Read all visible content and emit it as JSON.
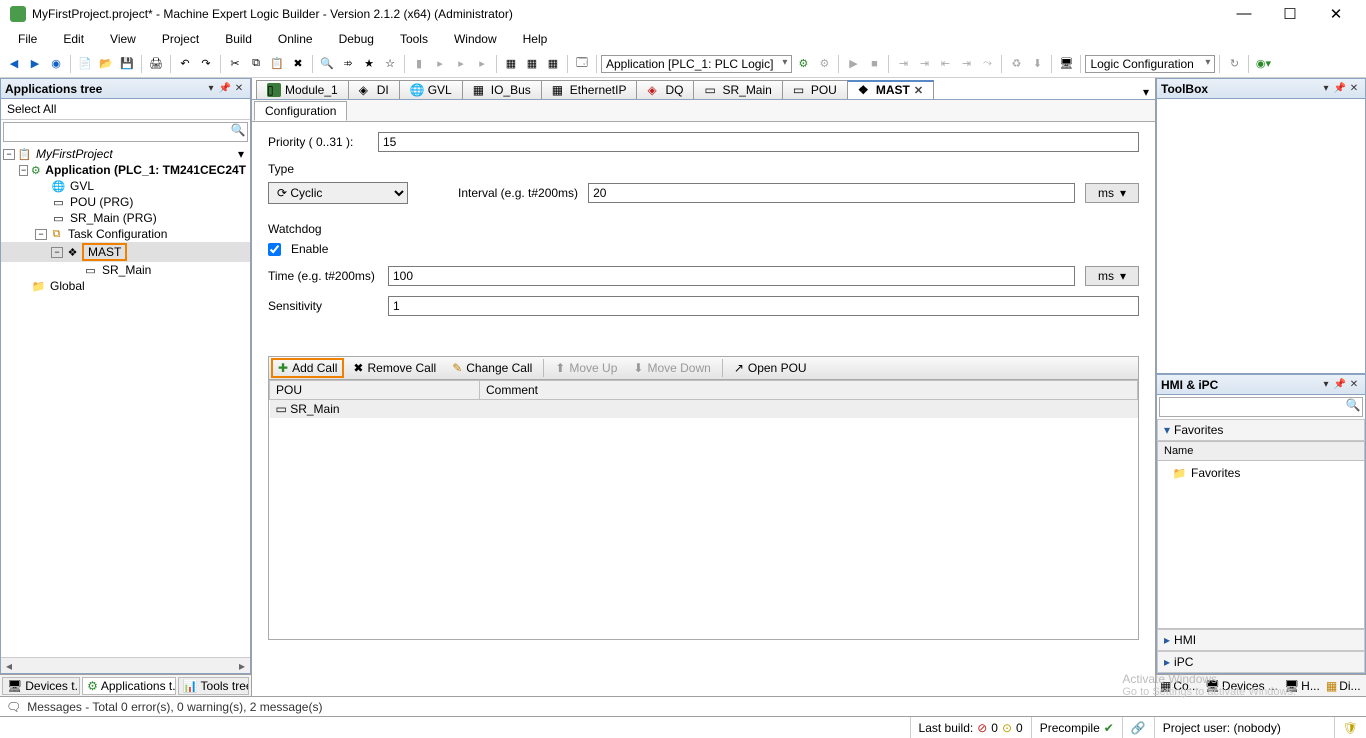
{
  "window": {
    "title": "MyFirstProject.project* - Machine Expert Logic Builder - Version 2.1.2 (x64) (Administrator)"
  },
  "menu": [
    "File",
    "Edit",
    "View",
    "Project",
    "Build",
    "Online",
    "Debug",
    "Tools",
    "Window",
    "Help"
  ],
  "toolbar": {
    "app_combo": "Application [PLC_1: PLC Logic]",
    "config_combo": "Logic Configuration"
  },
  "left_panel": {
    "title": "Applications tree",
    "select_all": "Select All",
    "tree": {
      "project": "MyFirstProject",
      "application": "Application (PLC_1: TM241CEC24T",
      "gvl": "GVL",
      "pou": "POU (PRG)",
      "sr_main_prg": "SR_Main (PRG)",
      "task_config": "Task Configuration",
      "mast": "MAST",
      "sr_main_task": "SR_Main",
      "global": "Global"
    },
    "bottom_tabs": {
      "devices": "Devices t...",
      "apps": "Applications t...",
      "tools": "Tools tree"
    }
  },
  "doc_tabs": [
    "Module_1",
    "DI",
    "GVL",
    "IO_Bus",
    "EthernetIP",
    "DQ",
    "SR_Main",
    "POU",
    "MAST"
  ],
  "subtab": "Configuration",
  "form": {
    "priority_label": "Priority ( 0..31 ):",
    "priority_value": "15",
    "type_label": "Type",
    "type_value": "Cyclic",
    "interval_label": "Interval (e.g. t#200ms)",
    "interval_value": "20",
    "interval_unit": "ms",
    "watchdog_label": "Watchdog",
    "enable_label": "Enable",
    "time_label": "Time (e.g. t#200ms)",
    "time_value": "100",
    "time_unit": "ms",
    "sensitivity_label": "Sensitivity",
    "sensitivity_value": "1"
  },
  "call_toolbar": {
    "add": "Add Call",
    "remove": "Remove Call",
    "change": "Change Call",
    "moveup": "Move Up",
    "movedown": "Move Down",
    "open": "Open POU"
  },
  "call_table": {
    "col_pou": "POU",
    "col_comment": "Comment",
    "row1_pou": "SR_Main"
  },
  "toolbox": {
    "title": "ToolBox"
  },
  "hmi": {
    "title": "HMI & iPC",
    "favorites": "Favorites",
    "name_col": "Name",
    "fav_item": "Favorites",
    "hmi_section": "HMI",
    "ipc_section": "iPC"
  },
  "mini_tabs": {
    "co": "Co...",
    "devices": "Devices ...",
    "h": "H...",
    "di": "Di..."
  },
  "msgbar": "Messages - Total 0 error(s), 0 warning(s), 2 message(s)",
  "status": {
    "last_build": "Last build:",
    "err": "0",
    "warn": "0",
    "precompile": "Precompile",
    "project_user": "Project user: (nobody)"
  },
  "watermark": {
    "title": "Activate Windows",
    "sub": "Go to Settings to activate Windows."
  }
}
